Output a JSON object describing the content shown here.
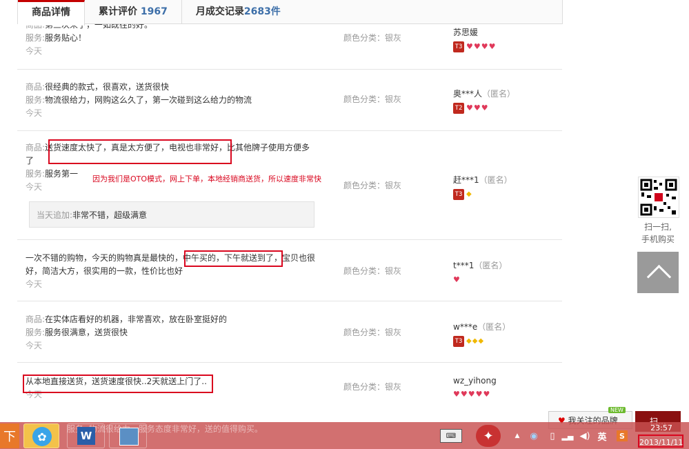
{
  "tabs": [
    {
      "label": "商品详情",
      "count": ""
    },
    {
      "label": "累计评价",
      "count": "1967"
    },
    {
      "label": "月成交记录",
      "count": "2683件"
    }
  ],
  "reviews": [
    {
      "lines": [
        {
          "label": "商品:",
          "text": "第三次来了，一如既往的好。"
        },
        {
          "label": "服务:",
          "text": "服务贴心！"
        }
      ],
      "date": "今天",
      "color": "颜色分类：银灰",
      "user": "苏思媛",
      "anon": ""
    },
    {
      "lines": [
        {
          "label": "商品:",
          "text": "很经典的款式，很喜欢，送货很快"
        },
        {
          "label": "服务:",
          "text": "物流很给力，网购这么久了，第一次碰到这么给力的物流"
        }
      ],
      "date": "今天",
      "color": "颜色分类：银灰",
      "user": "奥***人",
      "anon": "（匿名）"
    },
    {
      "lines": [
        {
          "label": "商品:",
          "text": "送货速度太快了，真是太方便了，电视也非常好，比其他牌子使用方便多"
        },
        {
          "label": "",
          "text": "了"
        },
        {
          "label": "服务:",
          "text": "服务第一"
        }
      ],
      "date": "今天",
      "color": "颜色分类：银灰",
      "user": "赶***1",
      "anon": "（匿名）",
      "append_label": "当天追加:",
      "append_text": "非常不错，超级满意",
      "annotation": "因为我们是OTO模式，网上下单，本地经销商送货，所以速度非常快"
    },
    {
      "lines": [
        {
          "label": "",
          "text": "一次不错的购物，今天的购物真是最快的，中午买的，下午就送到了，宝贝也很"
        },
        {
          "label": "",
          "text": "好，简洁大方，很实用的一款，性价比也好"
        }
      ],
      "date": "今天",
      "color": "颜色分类：银灰",
      "user": "t***1",
      "anon": "（匿名）"
    },
    {
      "lines": [
        {
          "label": "商品:",
          "text": "在实体店看好的机器，非常喜欢，放在卧室挺好的"
        },
        {
          "label": "服务:",
          "text": "服务很满意，送货很快"
        }
      ],
      "date": "今天",
      "color": "颜色分类：银灰",
      "user": "w***e",
      "anon": "（匿名）"
    },
    {
      "lines": [
        {
          "label": "",
          "text": "从本地直接送货，送货速度很快..2天就送上门了.."
        }
      ],
      "date": "今天",
      "color": "颜色分类：银灰",
      "user": "wz_yihong",
      "anon": ""
    }
  ],
  "sidebar": {
    "qr_label_1": "扫一扫,",
    "qr_label_2": "手机购买"
  },
  "follow_label": "我关注的品牌",
  "new_tag": "NEW",
  "scan_label": "扫…",
  "taskbar": {
    "underlying_text": "服务:   物流很给力，服务态度非常好，送的值得购买。",
    "tray_ime": "英",
    "time": "23:57",
    "date": "2013/11/11"
  },
  "colors": {
    "accent": "#c40000",
    "annotation_red": "#d9061e",
    "link_blue": "#3c6ea8"
  }
}
